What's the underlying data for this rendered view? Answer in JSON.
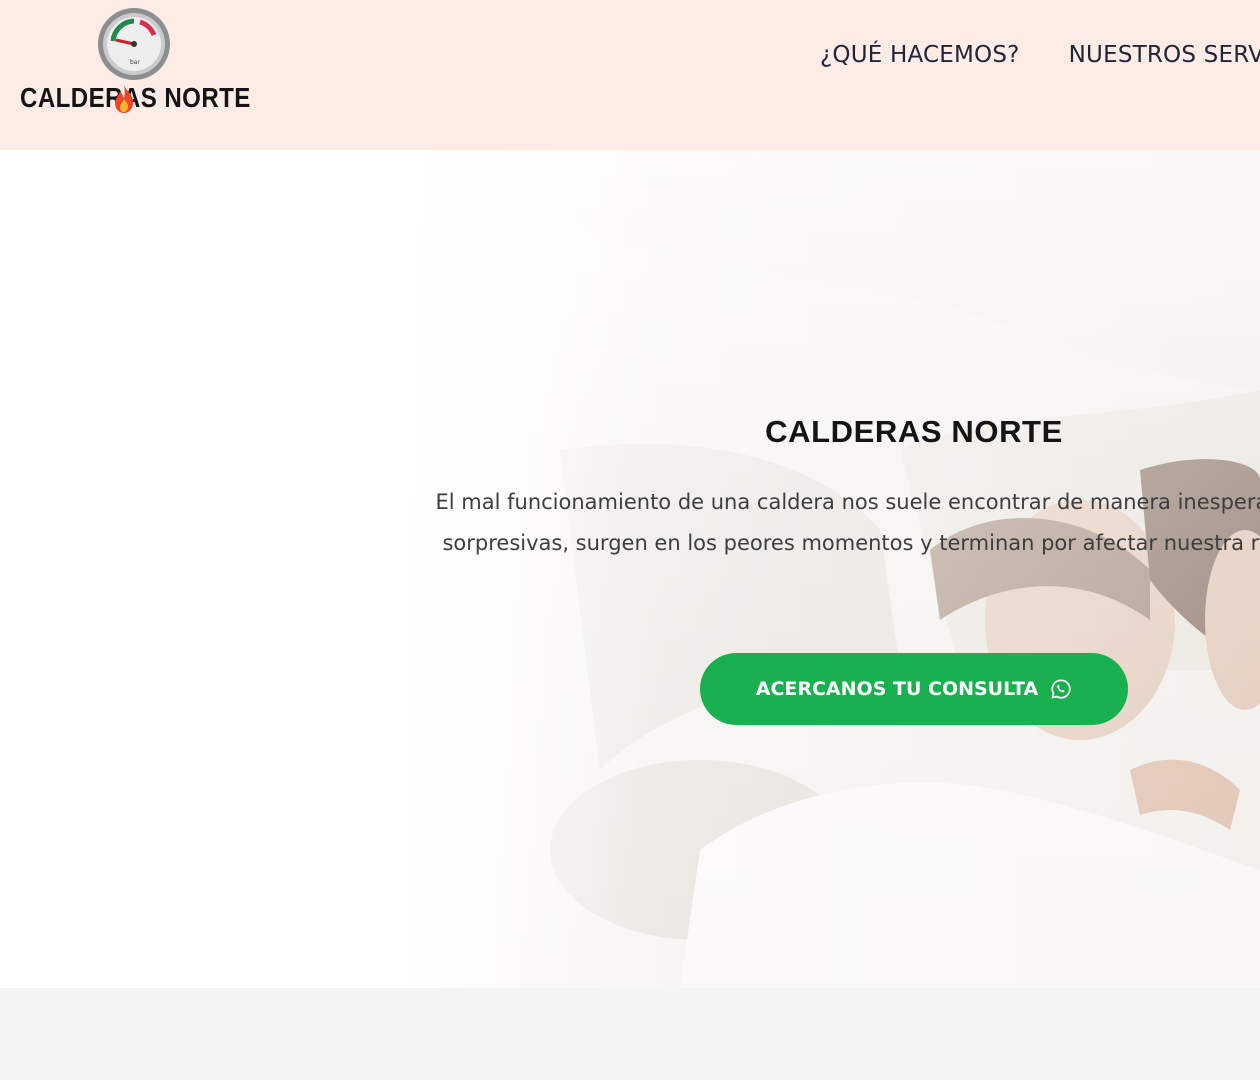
{
  "brand": {
    "logo_text": "CALDERAS NORTE",
    "gauge_label": "bar"
  },
  "nav": {
    "items": [
      {
        "label": "¿QUÉ HACEMOS?"
      },
      {
        "label": "NUESTROS SERVICIOS"
      }
    ]
  },
  "hero": {
    "title": "CALDERAS NORTE",
    "text": "El mal funcionamiento de una caldera nos suele encontrar de manera inesperada, siempre sorpresivas, surgen en los peores momentos y terminan por afectar nuestra rutina diaria.",
    "cta_label": "ACERCANOS TU CONSULTA",
    "cta_icon": "whatsapp-icon"
  },
  "colors": {
    "header_bg": "#fdebe5",
    "cta_bg": "#19b04f",
    "flame": "#e8472a"
  }
}
